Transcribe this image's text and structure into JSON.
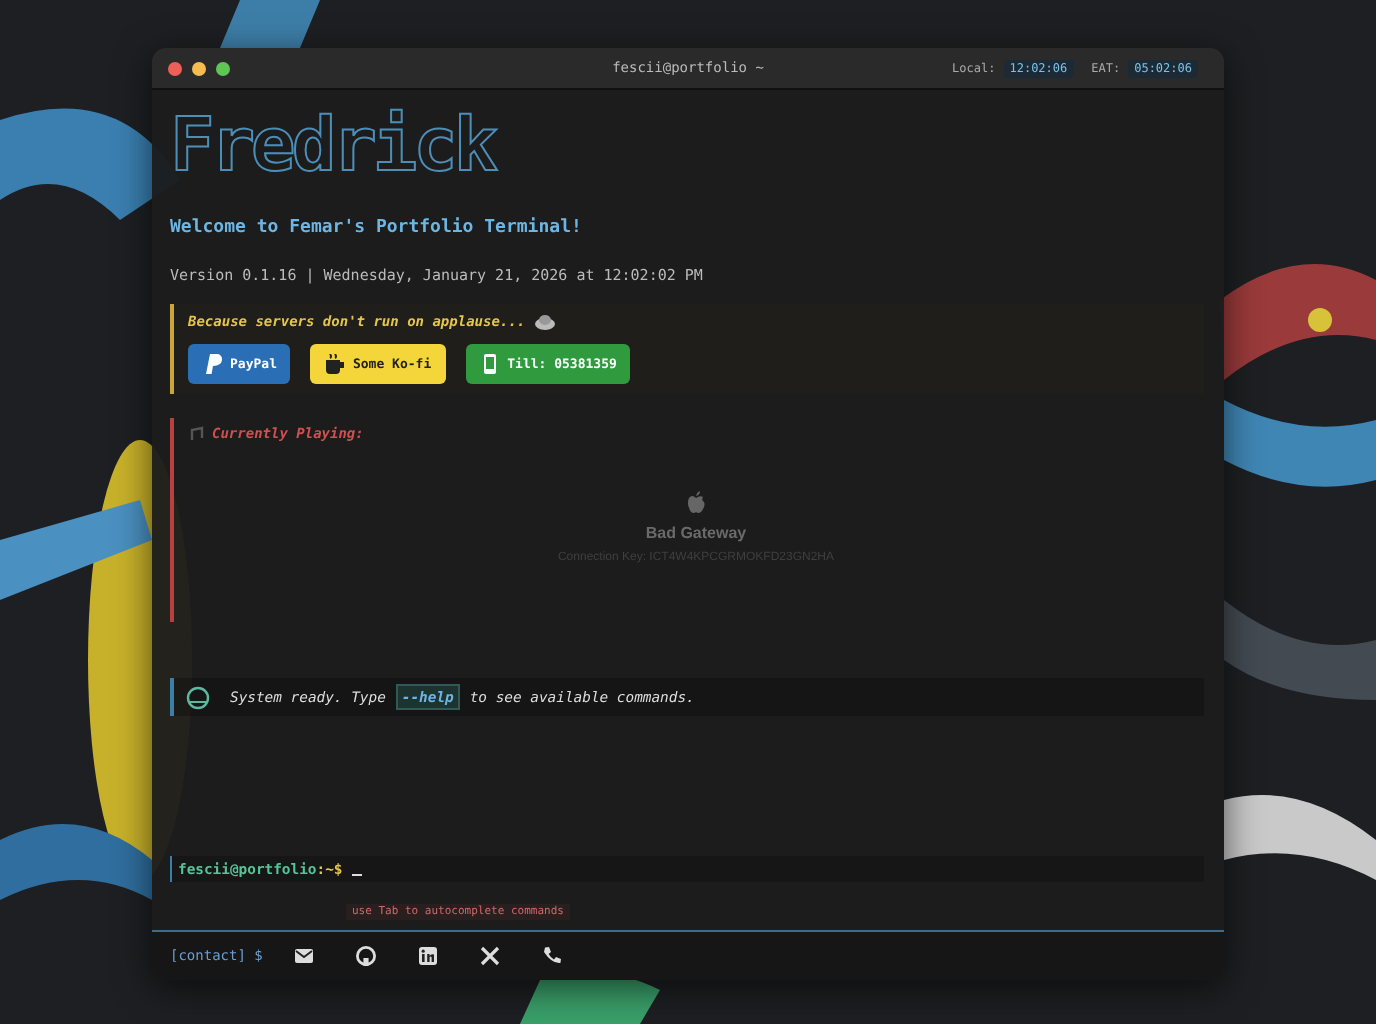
{
  "window": {
    "title": "fescii@portfolio ~",
    "clocks": [
      {
        "label": "Local:",
        "time": "12:02:06"
      },
      {
        "label": "EAT:",
        "time": "05:02:06"
      }
    ]
  },
  "banner": "Fredrick",
  "welcome": "Welcome to Femar's Portfolio Terminal!",
  "version_line": "Version 0.1.16 | Wednesday, January 21, 2026 at 12:02:02 PM",
  "support": {
    "tagline": "Because servers don't run on applause...",
    "buttons": [
      {
        "kind": "paypal",
        "label": "PayPal"
      },
      {
        "kind": "kofi",
        "label": "Some Ko-fi"
      },
      {
        "kind": "till",
        "label": "Till: 05381359"
      }
    ]
  },
  "now_playing": {
    "heading": "Currently Playing:",
    "error": "Bad Gateway",
    "detail": "Connection Key: ICT4W4KPCGRMOKFD23GN2HA"
  },
  "system_message": {
    "before": "System ready. Type",
    "command": "--help",
    "after": "to see available commands."
  },
  "prompt": {
    "user": "fescii",
    "host": "@portfolio",
    "path": ":~$",
    "hint": "use Tab to autocomplete commands"
  },
  "footer": {
    "label": "[contact] $",
    "links": [
      {
        "kind": "mail"
      },
      {
        "kind": "github"
      },
      {
        "kind": "linkedin"
      },
      {
        "kind": "x"
      },
      {
        "kind": "phone"
      }
    ]
  }
}
